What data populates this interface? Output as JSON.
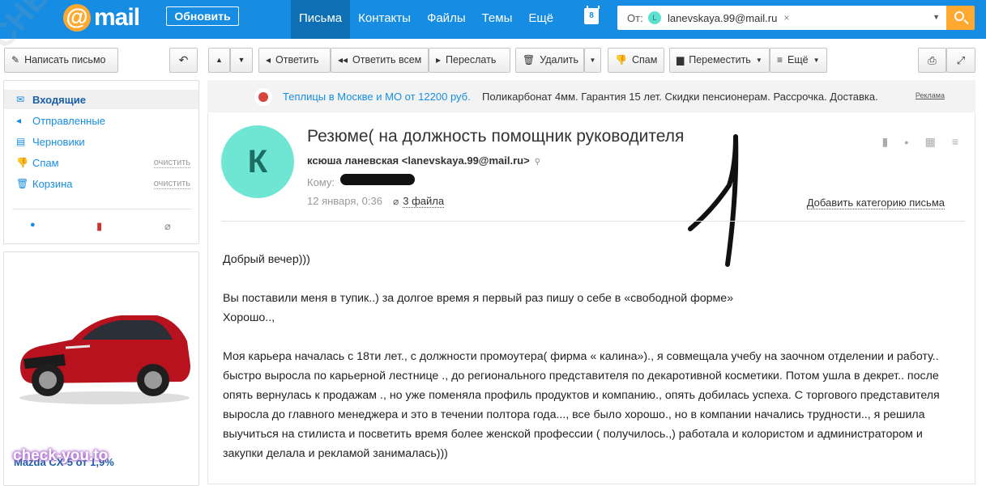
{
  "header": {
    "logo_at": "@",
    "logo_text": "mail",
    "refresh_label": "Обновить",
    "nav": [
      "Письма",
      "Контакты",
      "Файлы",
      "Темы",
      "Ещё"
    ],
    "calendar_day": "8",
    "search": {
      "label": "От:",
      "chip_initial": "L",
      "chip_text": "lanevskaya.99@mail.ru",
      "chip_remove": "×"
    }
  },
  "toolbar": {
    "compose": "Написать письмо",
    "reply": "Ответить",
    "reply_all": "Ответить всем",
    "forward": "Переслать",
    "delete": "Удалить",
    "spam": "Спам",
    "move": "Переместить",
    "more": "Ещё"
  },
  "sidebar": {
    "folders": [
      {
        "label": "Входящие",
        "action": ""
      },
      {
        "label": "Отправленные",
        "action": ""
      },
      {
        "label": "Черновики",
        "action": ""
      },
      {
        "label": "Спам",
        "action": "очистить"
      },
      {
        "label": "Корзина",
        "action": "очистить"
      }
    ]
  },
  "ad": {
    "title": "Mazda CX-5 от 1,9%",
    "subtitle": "",
    "watermark": "check-you.to"
  },
  "banner": {
    "link": "Теплицы в Москве и МО от 12200 руб.",
    "text": "Поликарбонат 4мм. Гарантия 15 лет. Скидки пенсионерам. Рассрочка. Доставка.",
    "ad_label": "Реклама"
  },
  "message": {
    "avatar_initial": "К",
    "subject": "Резюме( на должность помощник руководителя",
    "from": "ксюша ланевская <lanevskaya.99@mail.ru>",
    "to_label": "Кому:",
    "date": "12 января, 0:36",
    "files": "3 файла",
    "add_category": "Добавить категорию письма",
    "body": [
      "Добрый вечер)))",
      "",
      "Вы поставили меня в тупик..) за долгое время  я первый раз пишу о себе в «свободной форме»",
      "Хорошо..,",
      "",
      "Моя карьера началась  с 18ти лет., с должности промоутера( фирма « калина»)., я совмещала учебу на заочном отделении и работу.. быстро выросла по карьерной лестнице ., до регионального представителя по декаротивной косметики. Потом ушла в декрет.. после опять вернулась к продажам ., но уже поменяла профиль продуктов и компанию., опять добилась успеха. С торгового представителя выросла до главного менеджера и это в течении полтора года..., все было хорошо., но в компании начались трудности.., я решила выучиться на стилиста и посветить время более женской профессии ( получилось.,) работала и колористом и администратором и закупки делала и рекламой занималась)))"
    ]
  },
  "watermark_diag": "CHECK-YOU.ME",
  "colors": {
    "header_bg": "#168de2",
    "accent_orange": "#ffa930",
    "link_blue": "#168de2",
    "avatar_bg": "#6fe5d3"
  }
}
